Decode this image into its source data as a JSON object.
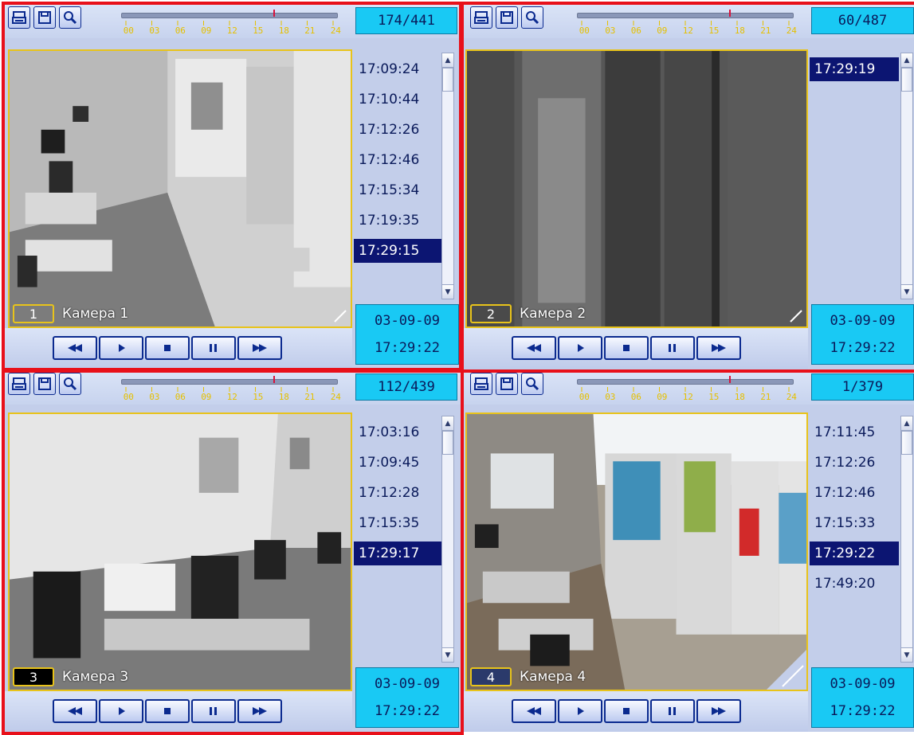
{
  "toolbar": {
    "icons": [
      "print-icon",
      "save-icon",
      "search-icon"
    ],
    "timeline_labels": [
      "00",
      "03",
      "06",
      "09",
      "12",
      "15",
      "18",
      "21",
      "24"
    ]
  },
  "colors": {
    "selection_frame": "#e8101a",
    "video_border": "#e8c31a",
    "counter_bg": "#19c9f4",
    "selected_time_bg": "#0c1572",
    "panel_bg": "#c3ceea"
  },
  "cameras": [
    {
      "number": "1",
      "label": "Камера 1",
      "counter": "174/441",
      "timeline_position": 0.71,
      "times": [
        "17:09:24",
        "17:10:44",
        "17:12:26",
        "17:12:46",
        "17:15:34",
        "17:19:35",
        "17:29:15"
      ],
      "selected_index": 6,
      "date": "03-09-09",
      "time": "17:29:22"
    },
    {
      "number": "2",
      "label": "Камера 2",
      "counter": "60/487",
      "timeline_position": 0.71,
      "times": [
        "17:29:19"
      ],
      "selected_index": 0,
      "date": "03-09-09",
      "time": "17:29:22"
    },
    {
      "number": "3",
      "label": "Камера 3",
      "counter": "112/439",
      "timeline_position": 0.71,
      "times": [
        "17:03:16",
        "17:09:45",
        "17:12:28",
        "17:15:35",
        "17:29:17"
      ],
      "selected_index": 4,
      "date": "03-09-09",
      "time": "17:29:22"
    },
    {
      "number": "4",
      "label": "Камера 4",
      "counter": "1/379",
      "timeline_position": 0.71,
      "times": [
        "17:11:45",
        "17:12:26",
        "17:12:46",
        "17:15:33",
        "17:29:22",
        "17:49:20"
      ],
      "selected_index": 4,
      "date": "03-09-09",
      "time": "17:29:22"
    }
  ],
  "playback_controls": [
    "rewind-icon",
    "play-icon",
    "stop-icon",
    "pause-icon",
    "fast-forward-icon"
  ]
}
